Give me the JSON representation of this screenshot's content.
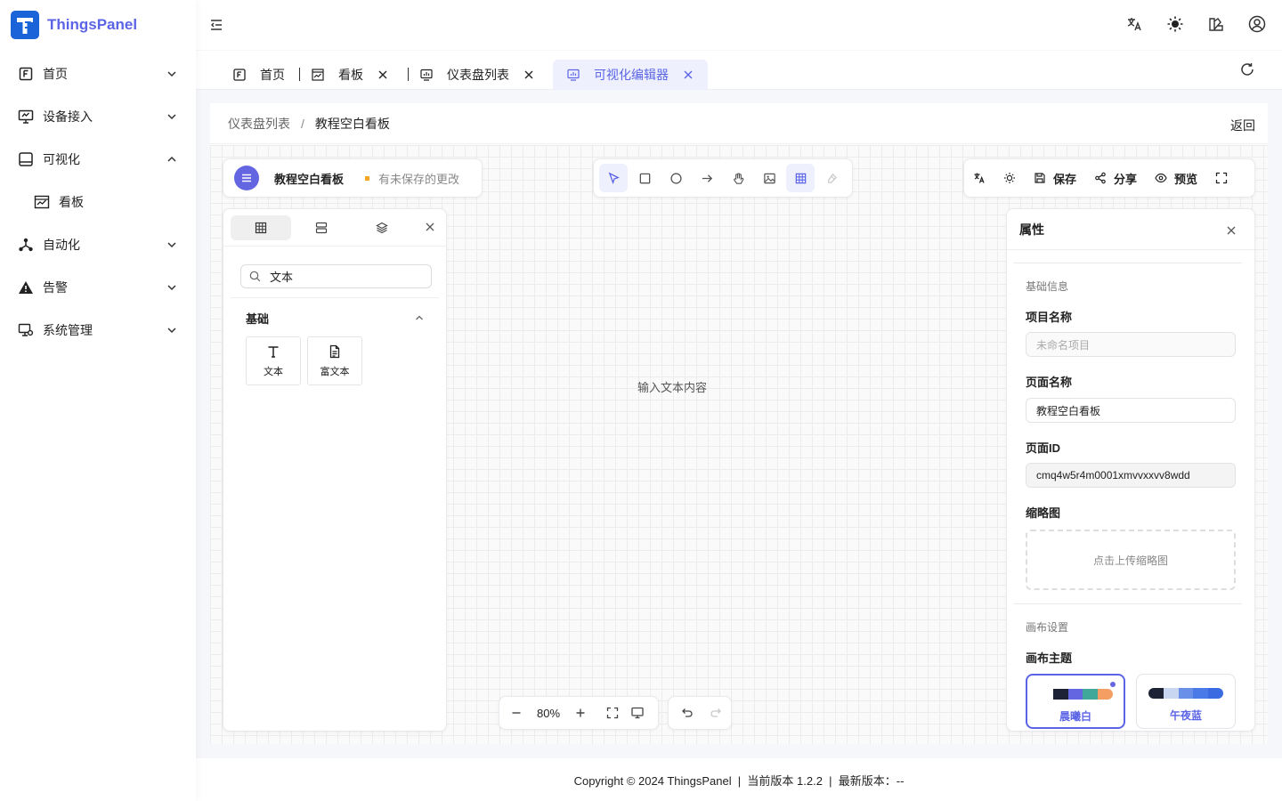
{
  "app": {
    "name": "ThingsPanel"
  },
  "sidebar": {
    "items": [
      {
        "label": "首页"
      },
      {
        "label": "设备接入"
      },
      {
        "label": "可视化"
      },
      {
        "label": "看板"
      },
      {
        "label": "自动化"
      },
      {
        "label": "告警"
      },
      {
        "label": "系统管理"
      }
    ]
  },
  "tabs": [
    {
      "label": "首页"
    },
    {
      "label": "看板"
    },
    {
      "label": "仪表盘列表"
    },
    {
      "label": "可视化编辑器"
    }
  ],
  "breadcrumb": {
    "parent": "仪表盘列表",
    "separator": "/",
    "current": "教程空白看板",
    "back": "返回"
  },
  "editor": {
    "title": "教程空白看板",
    "unsaved": "有未保存的更改",
    "actions": {
      "save": "保存",
      "share": "分享",
      "preview": "预览"
    },
    "canvas_text": "输入文本内容",
    "zoom": "80%"
  },
  "components": {
    "search_value": "文本",
    "section": "基础",
    "items": [
      {
        "label": "文本"
      },
      {
        "label": "富文本"
      }
    ]
  },
  "properties": {
    "title": "属性",
    "basic_section": "基础信息",
    "project_name_label": "项目名称",
    "project_name_placeholder": "未命名项目",
    "page_name_label": "页面名称",
    "page_name_value": "教程空白看板",
    "page_id_label": "页面ID",
    "page_id_value": "cmq4w5r4m0001xmvvxxvv8wdd",
    "thumbnail_label": "缩略图",
    "upload_text": "点击上传缩略图",
    "canvas_section": "画布设置",
    "theme_label": "画布主题",
    "themes": [
      {
        "name": "晨曦白",
        "selected": true,
        "colors": [
          "#ffffff",
          "#1e2235",
          "#6366e0",
          "#3fa89a",
          "#f59e63"
        ]
      },
      {
        "name": "午夜蓝",
        "selected": false,
        "colors": [
          "#1e2235",
          "#c9d6f2",
          "#6a8fe8",
          "#4a7ae8",
          "#3b6be0"
        ]
      }
    ]
  },
  "footer": {
    "text": "Copyright © 2024 ThingsPanel  |  当前版本 1.2.2  |  最新版本：--"
  },
  "colors": {
    "accent": "#5b64e6",
    "logo": "#1a63d8",
    "unsaved_dot": "#f5a623"
  }
}
